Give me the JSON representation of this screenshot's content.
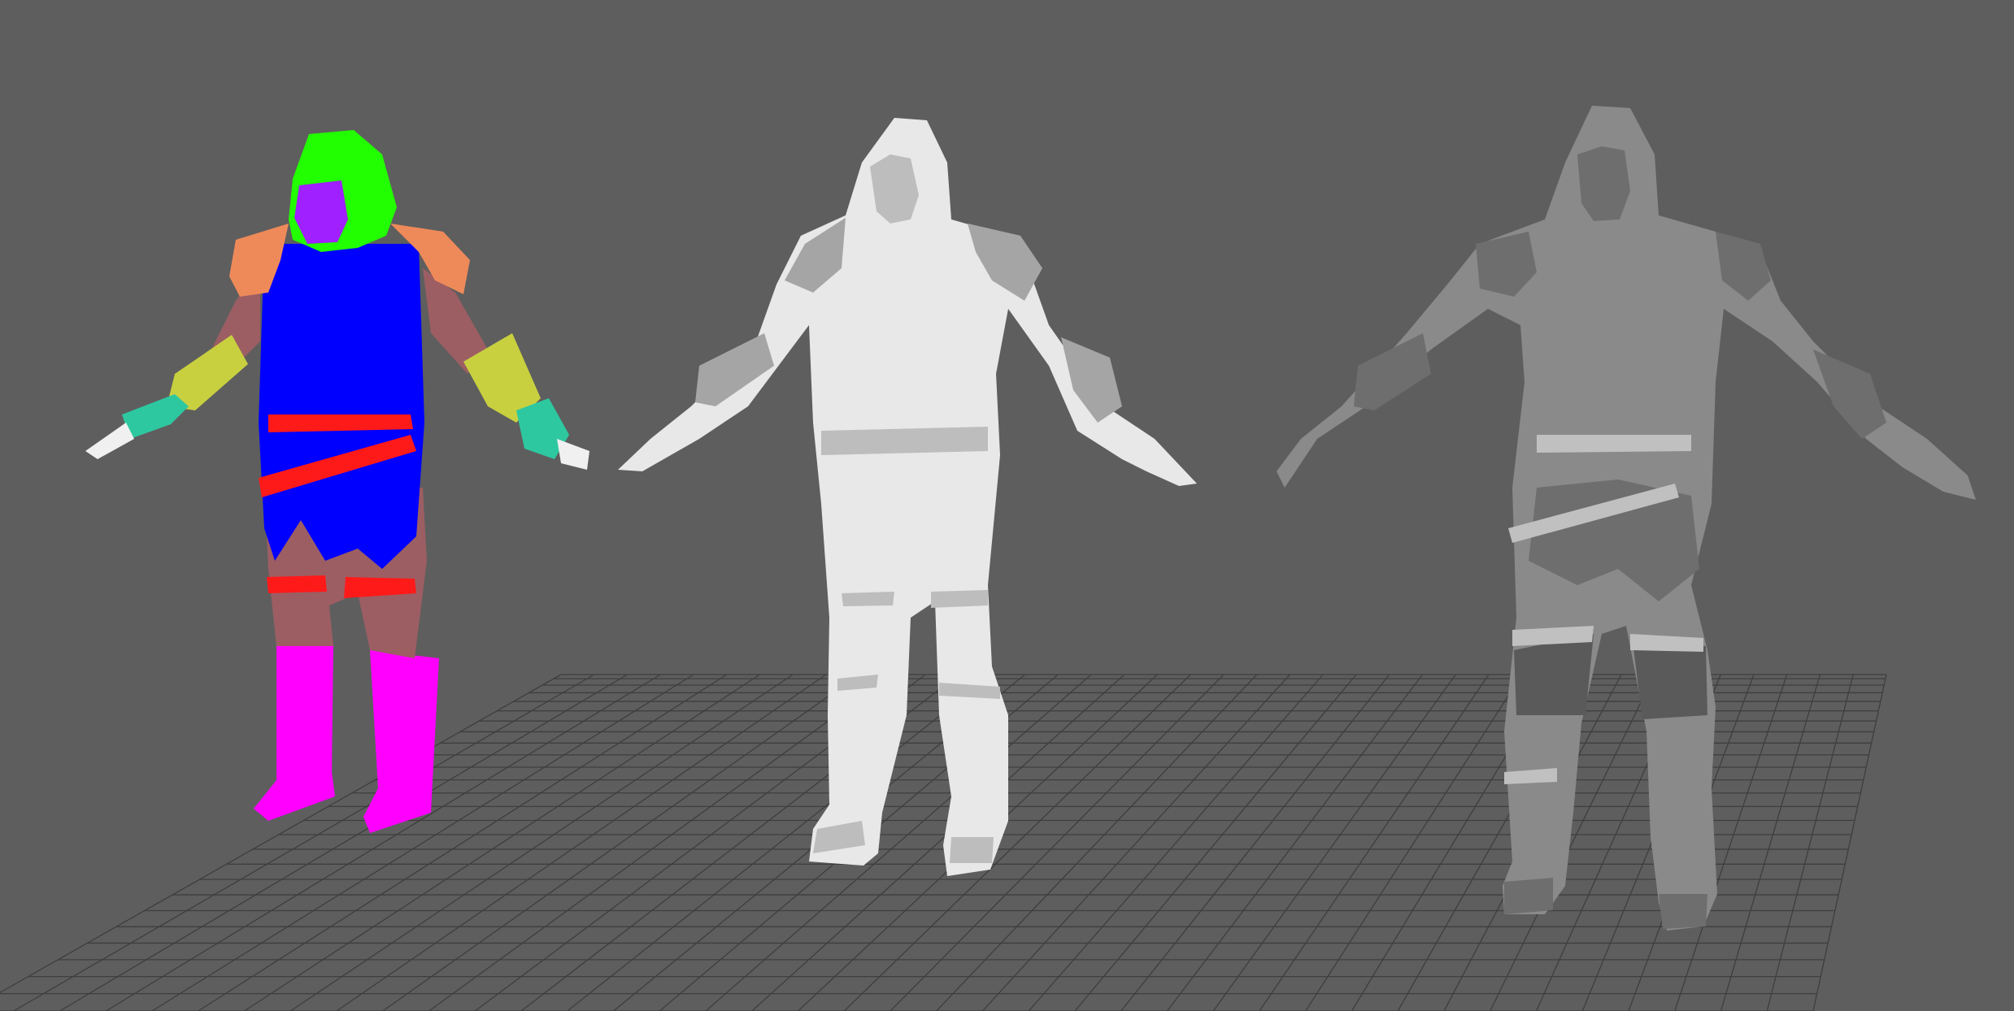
{
  "viewport": {
    "background": "#5e5e5e",
    "grid_color": "#3e3e3e",
    "grid_visible": true
  },
  "models": [
    {
      "id": "material-id-preview",
      "shading": "color-id",
      "parts": {
        "hood": "#22ff00",
        "face": "#a020ff",
        "shoulder_pads": "#ee8a5a",
        "tunic": "#0000ff",
        "arms": "#9c5e63",
        "bracers": "#c8d040",
        "gloves": "#2ec8a0",
        "belts": "#ff1a1a",
        "legs": "#9c5e63",
        "boots": "#ff00ff",
        "fingertips": "#f0f0f0"
      }
    },
    {
      "id": "white-clay-preview",
      "shading": "clay-light",
      "parts": {
        "body": "#e8e8e8",
        "shade": "#bdbdbd",
        "edge": "#a5a5a5"
      }
    },
    {
      "id": "gray-clay-preview",
      "shading": "clay-dark",
      "parts": {
        "body": "#8a8a8a",
        "shade": "#6e6e6e",
        "edge": "#c0c0c0",
        "legs": "#5a5a5a"
      }
    }
  ]
}
